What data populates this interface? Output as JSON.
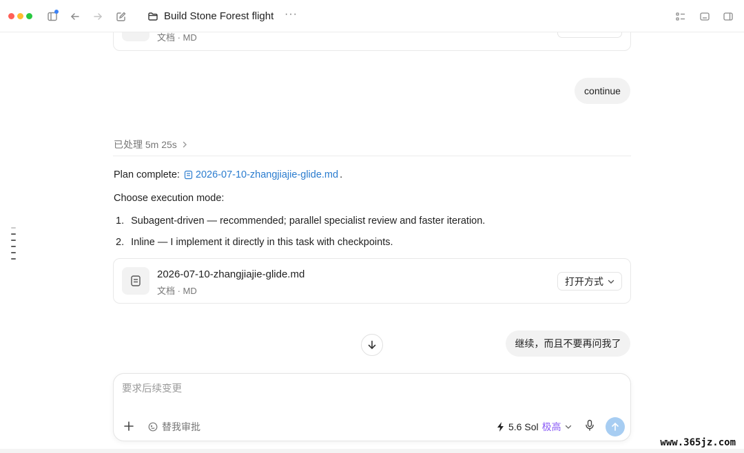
{
  "window": {
    "title": "Build Stone Forest flight",
    "more_label": "···"
  },
  "top_file_card": {
    "meta": "文档 · MD"
  },
  "messages": {
    "user_continue": "continue",
    "processed_label": "已处理 5m 25s",
    "plan_prefix": "Plan complete:",
    "plan_file_link": "2026-07-10-zhangjiajie-glide.md",
    "plan_suffix": ".",
    "choose_mode": "Choose execution mode:",
    "options": [
      {
        "num": "1.",
        "text": "Subagent-driven — recommended; parallel specialist review and faster iteration."
      },
      {
        "num": "2.",
        "text": "Inline — I implement it directly in this task with checkpoints."
      }
    ],
    "user_followup": "继续，而且不要再问我了"
  },
  "file_card": {
    "name": "2026-07-10-zhangjiajie-glide.md",
    "meta": "文档 · MD",
    "open_with_label": "打开方式"
  },
  "composer": {
    "placeholder": "要求后续变更",
    "approve_label": "替我审批",
    "model_name": "5.6 Sol",
    "model_level": "极高"
  },
  "watermark": "www.365jz.com",
  "colors": {
    "link": "#2a7ccf",
    "model_level": "#8b5cf6",
    "send_button": "#a7cdf2"
  }
}
